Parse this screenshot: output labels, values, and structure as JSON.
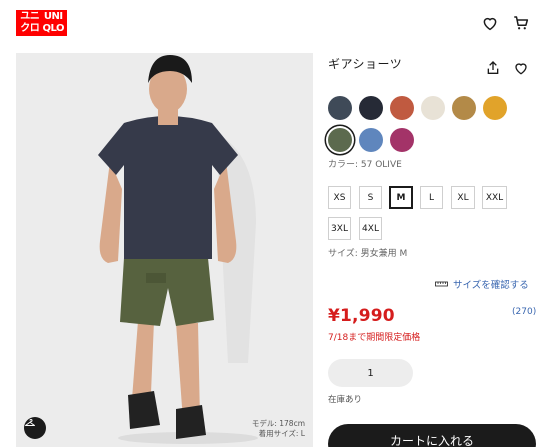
{
  "header": {
    "logo_top_left": "ユニ",
    "logo_top_right": "UNI",
    "logo_bottom_left": "クロ",
    "logo_bottom_right": "QLO",
    "icons": [
      "heart-icon",
      "cart-icon"
    ]
  },
  "product": {
    "title": "ギアショーツ",
    "colors": [
      {
        "name": "navy-gray",
        "hex": "#3f4a58"
      },
      {
        "name": "dark-navy",
        "hex": "#262a36"
      },
      {
        "name": "orange-red",
        "hex": "#c05a40"
      },
      {
        "name": "off-white",
        "hex": "#e8e2d6"
      },
      {
        "name": "khaki",
        "hex": "#b38a48"
      },
      {
        "name": "yellow",
        "hex": "#e1a32a"
      },
      {
        "name": "olive",
        "hex": "#5c6a4e",
        "selected": true
      },
      {
        "name": "blue",
        "hex": "#5f86bd"
      },
      {
        "name": "wine",
        "hex": "#a33368"
      }
    ],
    "color_label": "カラー: 57 OLIVE",
    "sizes": [
      {
        "label": "XS",
        "selected": false
      },
      {
        "label": "S",
        "selected": false
      },
      {
        "label": "M",
        "selected": true
      },
      {
        "label": "L",
        "selected": false
      },
      {
        "label": "XL",
        "selected": false
      },
      {
        "label": "XXL",
        "selected": false
      },
      {
        "label": "3XL",
        "selected": false
      },
      {
        "label": "4XL",
        "selected": false
      }
    ],
    "size_label": "サイズ: 男女兼用 M",
    "size_check_link": "サイズを確認する",
    "price": "¥1,990",
    "review_count": "(270)",
    "price_note": "7/18まで期間限定価格",
    "quantity": "1",
    "stock_status": "在庫あり",
    "add_to_cart": "カートに入れる"
  },
  "photo": {
    "model_height": "モデル: 178cm",
    "model_size": "着用サイズ: L"
  },
  "colors": {
    "brand_red": "#ff0000",
    "price_red": "#d51d1d",
    "link_blue": "#3a67b0"
  }
}
